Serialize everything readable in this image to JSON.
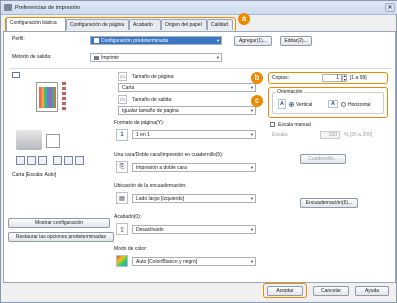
{
  "window": {
    "title": "Preferencias de impresión"
  },
  "tabs": [
    {
      "label": "Configuración básica"
    },
    {
      "label": "Configuración de página"
    },
    {
      "label": "Acabado"
    },
    {
      "label": "Origen del papel"
    },
    {
      "label": "Calidad"
    }
  ],
  "badges": [
    "a",
    "b",
    "c"
  ],
  "profile": {
    "label": "Perfil:",
    "value": "Configuración predeterminada",
    "add_button": "Agregar(1)...",
    "edit_button": "Editar(2)..."
  },
  "output_method": {
    "label": "Método de salida:",
    "value": "Imprimir"
  },
  "page_size": {
    "label": "Tamaño de página:",
    "value": "Carta"
  },
  "output_size": {
    "label": "Tamaño de salida:",
    "value": "Igualar tamaño de página"
  },
  "copies": {
    "label": "Copias:",
    "value": "1",
    "range": "[1 a 99]"
  },
  "orientation": {
    "title": "Orientación",
    "portrait": "Vertical",
    "landscape": "Horizontal"
  },
  "page_layout": {
    "label": "Formato de página(Y):",
    "value": "1 en 1"
  },
  "duplex": {
    "label": "Una cara/Doble cara/Impresión en cuadernillo(5):",
    "value": "Impresión a doble cara"
  },
  "binding": {
    "label": "Ubicación de la encuadernación:",
    "value": "Lado largo [izquierdo]"
  },
  "finishing": {
    "label": "Acabado(0):",
    "value": "Desactivado"
  },
  "color_mode": {
    "label": "Modo de color:",
    "value": "Auto [Color/Blanco y negro]"
  },
  "manual_scale": {
    "label": "Escala manual",
    "scale_label": "Escala:",
    "scale_value": "100",
    "scale_range": "% [25 a 200]"
  },
  "booklet_button": "Cuadernillo...",
  "binding_button": "Encuadernación(6)...",
  "preview_caption": "Carta [Escala: Auto]",
  "show_settings_button": "Mostrar configuración",
  "restore_button": "Restaurar las opciones predeterminadas",
  "footer": {
    "ok": "Aceptar",
    "cancel": "Cancelar",
    "help": "Ayuda"
  }
}
